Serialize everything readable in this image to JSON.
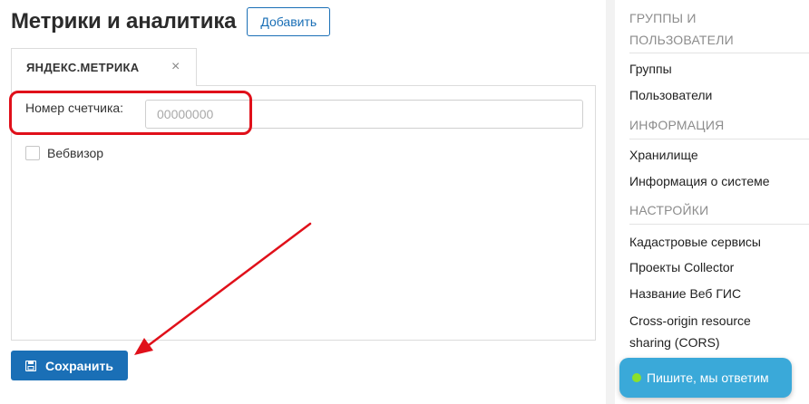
{
  "header": {
    "title": "Метрики и аналитика",
    "add_label": "Добавить"
  },
  "tabs": [
    {
      "label": "ЯНДЕКС.МЕТРИКА",
      "close_icon": "×"
    }
  ],
  "form": {
    "counter_label": "Номер счетчика:",
    "counter_placeholder": "00000000",
    "counter_value": "",
    "webvisor_label": "Вебвизор",
    "webvisor_checked": false
  },
  "save_label": "Сохранить",
  "sidebar": {
    "sections": [
      {
        "title_line1": "ГРУППЫ И",
        "title_line2": "ПОЛЬЗОВАТЕЛИ",
        "items": [
          "Группы",
          "Пользователи"
        ]
      },
      {
        "title": "ИНФОРМАЦИЯ",
        "items": [
          "Хранилище",
          "Информация о системе"
        ]
      },
      {
        "title": "НАСТРОЙКИ",
        "items": [
          "Кадастровые сервисы",
          "Проекты Collector",
          "Название Веб ГИС",
          "Cross-origin resource",
          "sharing (CORS)"
        ]
      }
    ]
  },
  "chat": {
    "label": "Пишите, мы ответим",
    "status_color": "#8be02c"
  },
  "colors": {
    "accent": "#1a6fb6",
    "annotation": "#e0101a",
    "chat": "#3aa9d9"
  }
}
